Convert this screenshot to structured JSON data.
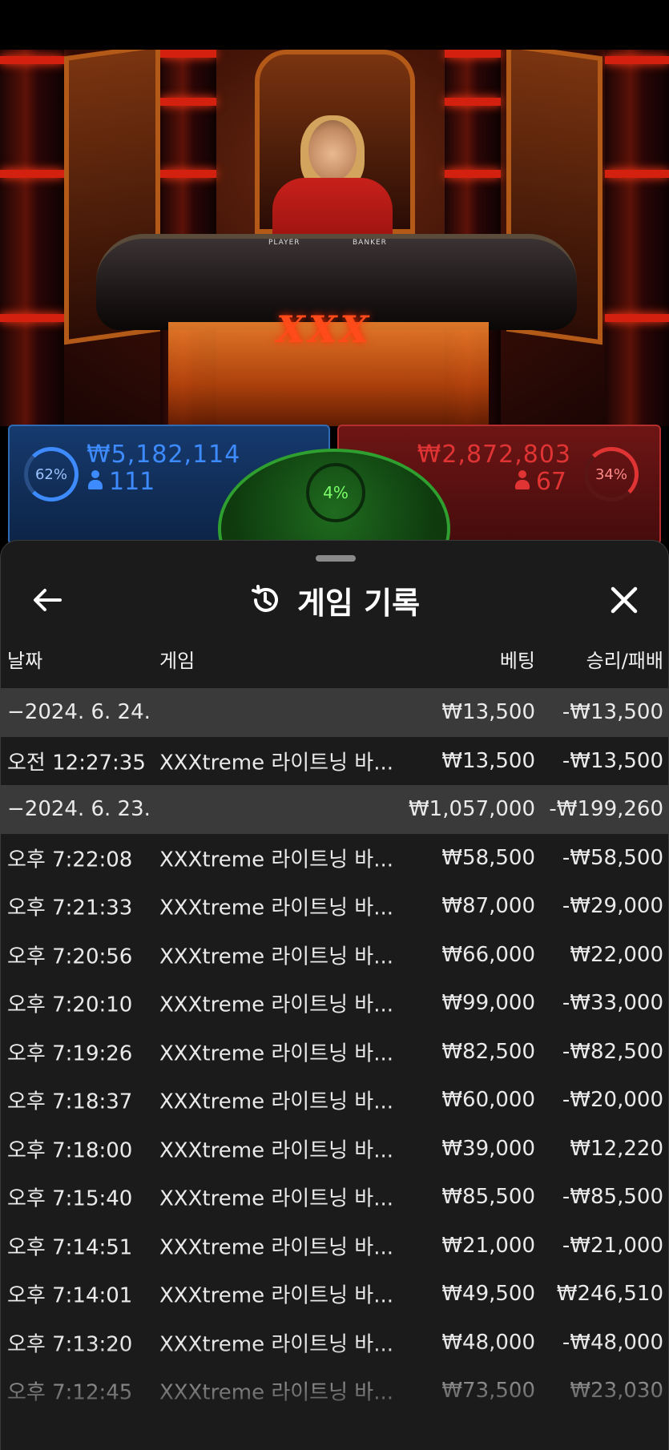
{
  "stats": {
    "player": {
      "percent": "62%",
      "amount": "₩5,182,114",
      "count": "111",
      "color": "#3d8bff"
    },
    "banker": {
      "percent": "34%",
      "amount": "₩2,872,803",
      "count": "67",
      "color": "#e03434"
    },
    "tie": {
      "percent": "4%",
      "color": "#7cff6a"
    }
  },
  "table_labels": {
    "player": "PLAYER",
    "banker": "BANKER",
    "logo": "XXX"
  },
  "sheet": {
    "title": "게임 기록",
    "columns": {
      "date": "날짜",
      "game": "게임",
      "bet": "베팅",
      "result": "승리/패배"
    }
  },
  "rows": [
    {
      "type": "day",
      "date": "−2024. 6. 24.",
      "game": "",
      "bet": "₩13,500",
      "result": "-₩13,500"
    },
    {
      "type": "game",
      "date": "오전 12:27:35",
      "game": "XXXtreme 라이트닝 바...",
      "bet": "₩13,500",
      "result": "-₩13,500"
    },
    {
      "type": "day",
      "date": "−2024. 6. 23.",
      "game": "",
      "bet": "₩1,057,000",
      "result": "-₩199,260"
    },
    {
      "type": "game",
      "date": "오후 7:22:08",
      "game": "XXXtreme 라이트닝 바...",
      "bet": "₩58,500",
      "result": "-₩58,500"
    },
    {
      "type": "game",
      "date": "오후 7:21:33",
      "game": "XXXtreme 라이트닝 바...",
      "bet": "₩87,000",
      "result": "-₩29,000"
    },
    {
      "type": "game",
      "date": "오후 7:20:56",
      "game": "XXXtreme 라이트닝 바...",
      "bet": "₩66,000",
      "result": "₩22,000"
    },
    {
      "type": "game",
      "date": "오후 7:20:10",
      "game": "XXXtreme 라이트닝 바...",
      "bet": "₩99,000",
      "result": "-₩33,000"
    },
    {
      "type": "game",
      "date": "오후 7:19:26",
      "game": "XXXtreme 라이트닝 바...",
      "bet": "₩82,500",
      "result": "-₩82,500"
    },
    {
      "type": "game",
      "date": "오후 7:18:37",
      "game": "XXXtreme 라이트닝 바...",
      "bet": "₩60,000",
      "result": "-₩20,000"
    },
    {
      "type": "game",
      "date": "오후 7:18:00",
      "game": "XXXtreme 라이트닝 바...",
      "bet": "₩39,000",
      "result": "₩12,220"
    },
    {
      "type": "game",
      "date": "오후 7:15:40",
      "game": "XXXtreme 라이트닝 바...",
      "bet": "₩85,500",
      "result": "-₩85,500"
    },
    {
      "type": "game",
      "date": "오후 7:14:51",
      "game": "XXXtreme 라이트닝 바...",
      "bet": "₩21,000",
      "result": "-₩21,000"
    },
    {
      "type": "game",
      "date": "오후 7:14:01",
      "game": "XXXtreme 라이트닝 바...",
      "bet": "₩49,500",
      "result": "₩246,510"
    },
    {
      "type": "game",
      "date": "오후 7:13:20",
      "game": "XXXtreme 라이트닝 바...",
      "bet": "₩48,000",
      "result": "-₩48,000"
    },
    {
      "type": "game",
      "date": "오후 7:12:45",
      "game": "XXXtreme 라이트닝 바...",
      "bet": "₩73,500",
      "result": "₩23,030"
    }
  ]
}
